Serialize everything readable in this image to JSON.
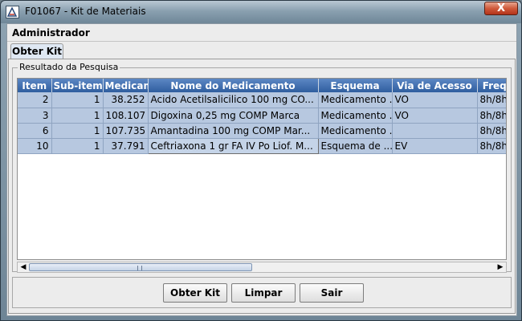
{
  "window": {
    "title": "F01067 - Kit de Materiais",
    "close_symbol": "X"
  },
  "header": {
    "user": "Administrador"
  },
  "tabs": [
    {
      "label": "Obter Kit",
      "selected": true
    }
  ],
  "results": {
    "group_title": "Resultado da Pesquisa",
    "columns": [
      "Item",
      "Sub-item",
      "Medicamento",
      "Nome do Medicamento",
      "Esquema",
      "Via de Acesso",
      "Frequência"
    ],
    "rows": [
      [
        "2",
        "1",
        "38.252",
        "Acido Acetilsalicilico    100 mg  CO...",
        "Medicamento ...",
        "VO",
        "8h/8h"
      ],
      [
        "3",
        "1",
        "108.107",
        "Digoxina    0,25 mg  COMP     Marca",
        "Medicamento ...",
        "VO",
        "8h/8h"
      ],
      [
        "6",
        "1",
        "107.735",
        "Amantadina    100 mg  COMP     Mar...",
        "Medicamento ...",
        "",
        "8h/8h"
      ],
      [
        "10",
        "1",
        "37.791",
        "Ceftriaxona    1 gr  FA  IV Po Liof.  M...",
        "Esquema de ...",
        "EV",
        "8h/8h"
      ]
    ],
    "focused_cell": {
      "row": 3,
      "col": 3
    }
  },
  "scrollbar": {
    "position": 0.0,
    "visible_fraction": 0.48
  },
  "buttons": {
    "obter_kit": "Obter Kit",
    "limpar": "Limpar",
    "sair": "Sair"
  },
  "colors": {
    "header_bg": "#2f5e9f",
    "selected_row_bg": "#b7c8e0",
    "close_button": "#cf5a3a"
  }
}
